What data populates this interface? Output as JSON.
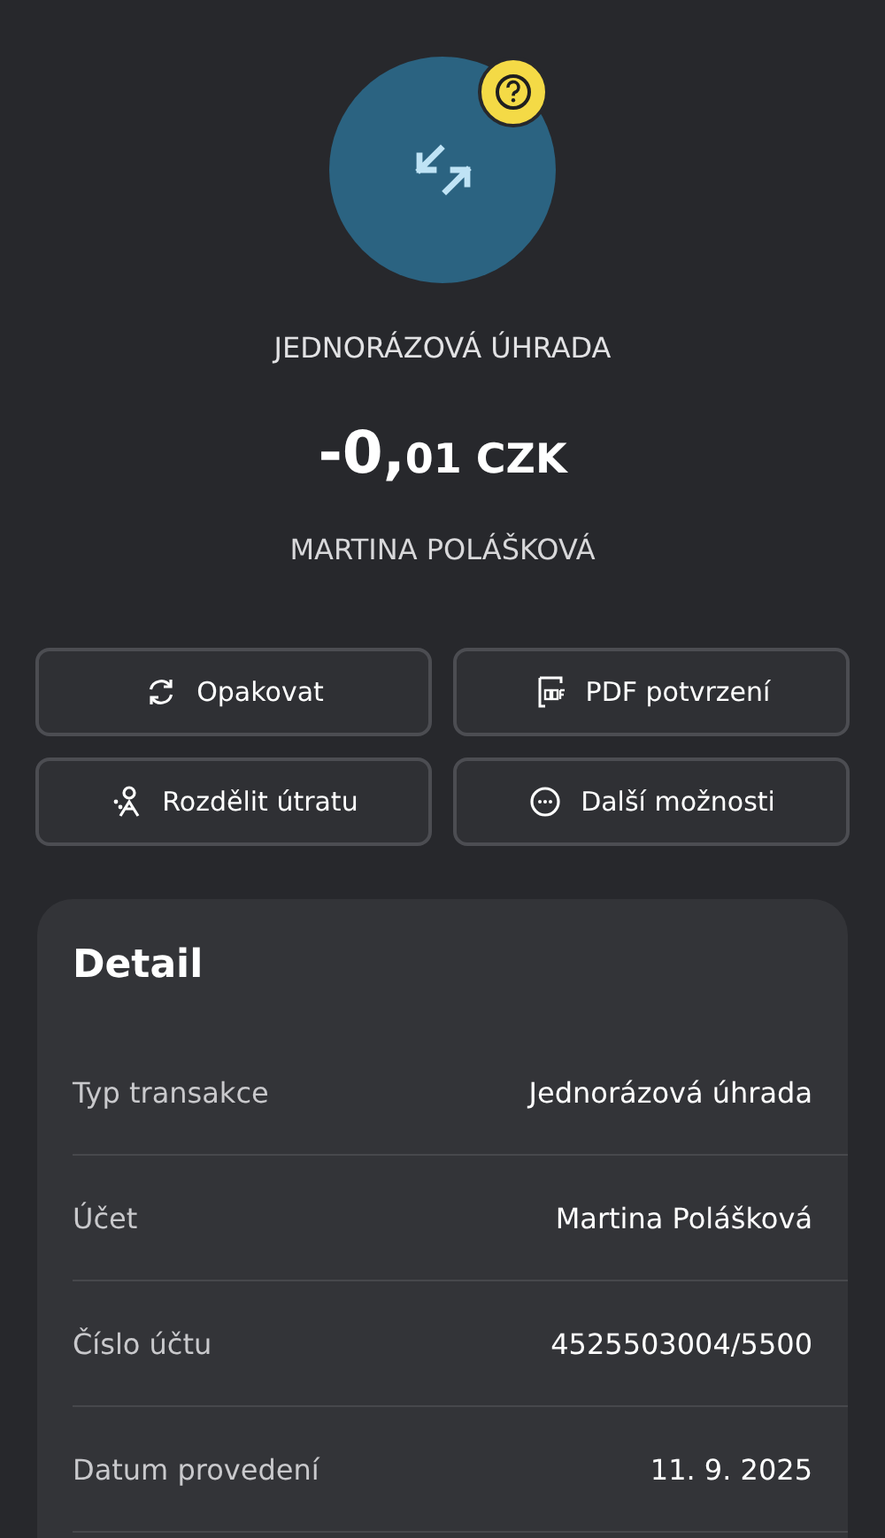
{
  "header": {
    "title": "JEDNORÁZOVÁ ÚHRADA",
    "amount": {
      "major": "-0,",
      "minor": "01 CZK"
    },
    "counterparty": "MARTINA POLÁŠKOVÁ"
  },
  "actions": [
    {
      "kind": "repeat",
      "label": "Opakovat"
    },
    {
      "kind": "pdf",
      "label": "PDF potvrzení"
    },
    {
      "kind": "split",
      "label": "Rozdělit útratu"
    },
    {
      "kind": "more",
      "label": "Další možnosti"
    }
  ],
  "detail": {
    "title": "Detail",
    "rows": [
      {
        "label": "Typ transakce",
        "value": "Jednorázová úhrada"
      },
      {
        "label": "Účet",
        "value": "Martina Polášková"
      },
      {
        "label": "Číslo účtu",
        "value": "4525503004/5500"
      },
      {
        "label": "Datum provedení",
        "value": "11. 9. 2025"
      }
    ]
  }
}
